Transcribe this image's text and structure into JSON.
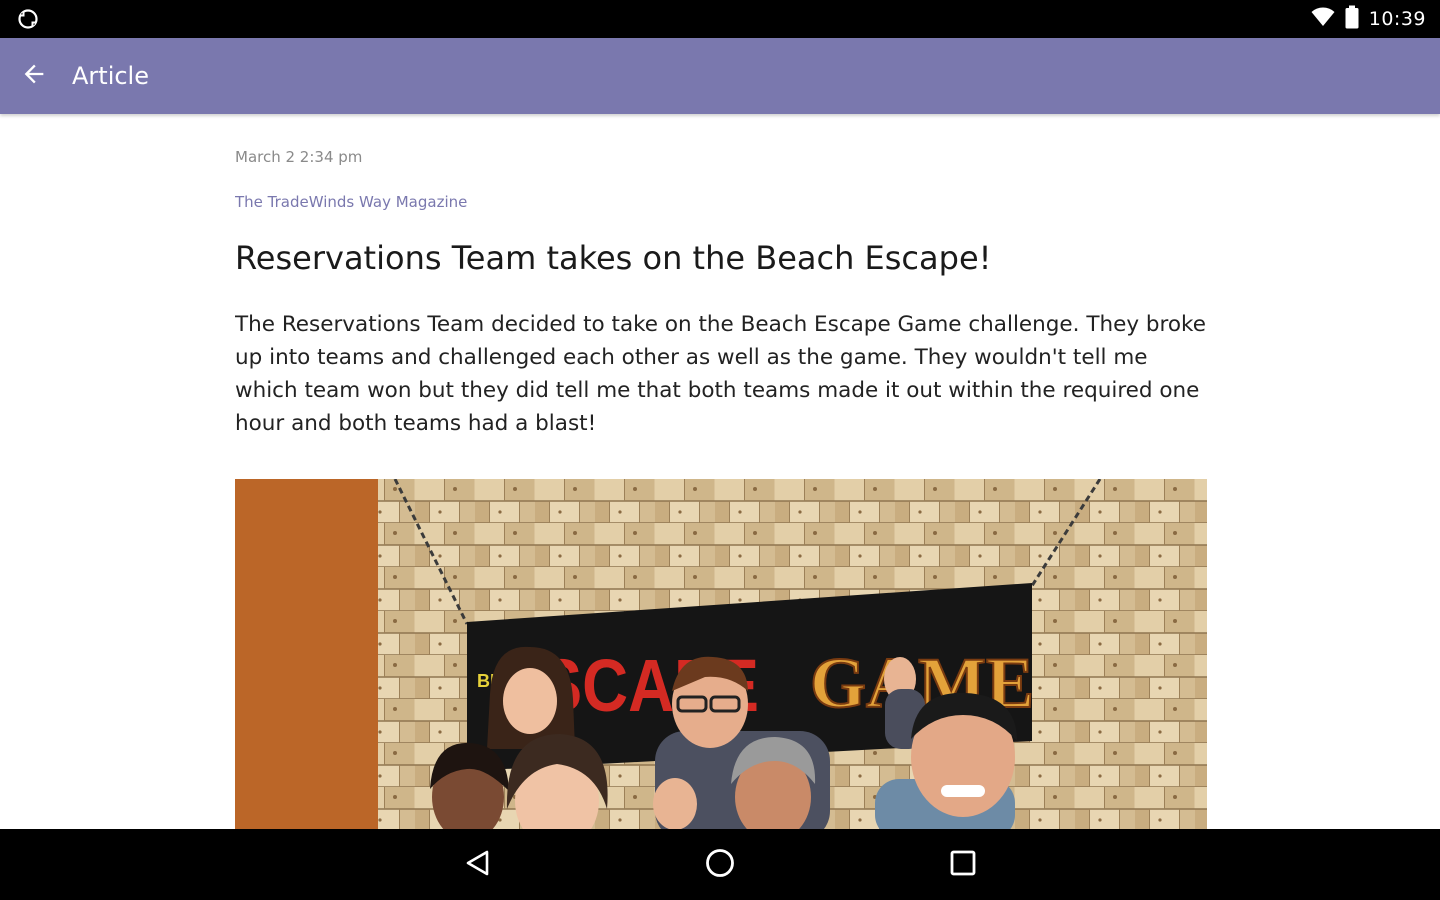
{
  "status_bar": {
    "time": "10:39",
    "left_icon": "sync-icon",
    "wifi_icon": "wifi-icon",
    "battery_icon": "battery-icon"
  },
  "app_bar": {
    "title": "Article",
    "back_icon": "arrow-back-icon",
    "background_color": "#7a78ae"
  },
  "article": {
    "date": "March 2 2:34 pm",
    "source": "The TradeWinds Way Magazine",
    "title": "Reservations Team takes on the Beach Escape!",
    "body": "The Reservations Team decided to take on the Beach Escape Game challenge. They broke up into teams and challenged each other as well as the game. They wouldn't tell me which team won but they did tell me that both teams made it out within the required one hour and both teams had a blast!",
    "photo": {
      "sign_text_left": "ESCAPE",
      "sign_text_right": "GAME"
    }
  },
  "nav_bar": {
    "back_icon": "nav-back-icon",
    "home_icon": "nav-home-icon",
    "recents_icon": "nav-recents-icon"
  }
}
